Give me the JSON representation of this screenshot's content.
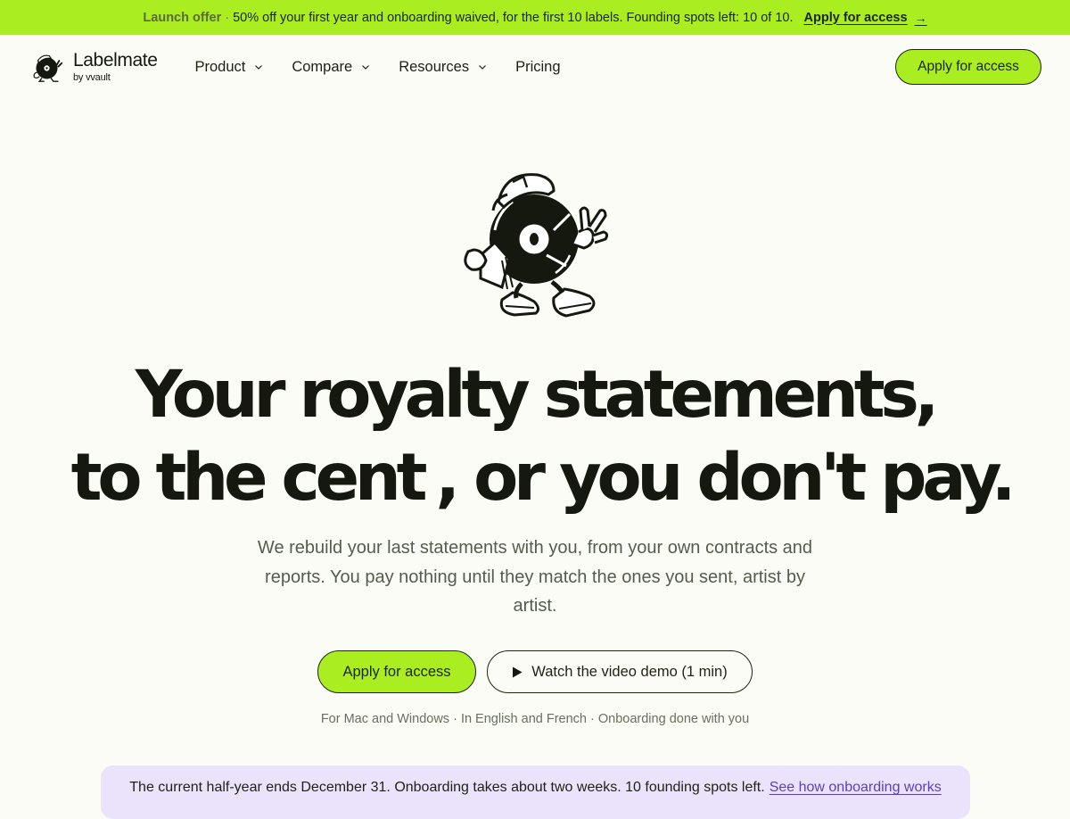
{
  "announcement": {
    "offer_label": "Launch offer",
    "separator": "·",
    "text": "50% off your first year and onboarding waived, for the first 10 labels. Founding spots left: 10 of 10.",
    "link_label": "Apply for access",
    "arrow": "→"
  },
  "brand": {
    "name": "Labelmate",
    "sub": "by vvault",
    "logo_icon": "vinyl-mascot-icon"
  },
  "nav": {
    "items": [
      {
        "label": "Product",
        "has_dropdown": true
      },
      {
        "label": "Compare",
        "has_dropdown": true
      },
      {
        "label": "Resources",
        "has_dropdown": true
      },
      {
        "label": "Pricing",
        "has_dropdown": false
      }
    ],
    "cta_label": "Apply for access"
  },
  "hero": {
    "mascot_icon": "vinyl-record-mascot-icon",
    "headline_line1": "Your royalty statements,",
    "headline_highlight": "to the cent",
    "headline_line2_rest": ", or you don't pay.",
    "subtitle": "We rebuild your last statements with you, from your own contracts and reports. You pay nothing until they match the ones you sent, artist by artist.",
    "primary_cta": "Apply for access",
    "secondary_cta": "Watch the video demo (1 min)",
    "meta": "For Mac and Windows · In English and French · Onboarding done with you"
  },
  "notice": {
    "text": "The current half-year ends December 31. Onboarding takes about two weeks. 10 founding spots left.",
    "link_label": "See how onboarding works"
  },
  "colors": {
    "accent": "#aaee22",
    "background": "#fbfcf6",
    "highlight": "#a47df7",
    "notice_bg": "#ebe3fb",
    "link": "#5b3ec2"
  }
}
